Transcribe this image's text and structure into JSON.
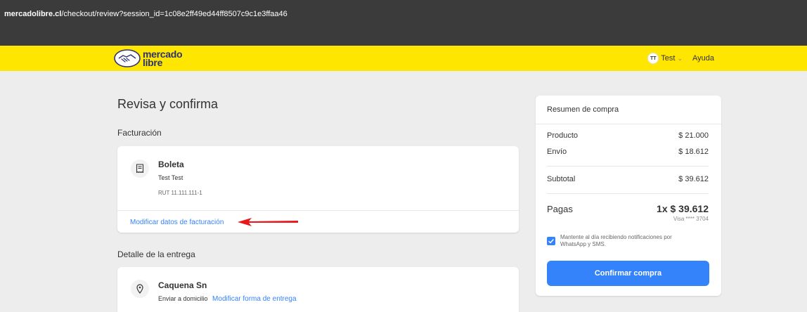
{
  "browser": {
    "url_host": "mercadolibre.cl",
    "url_path": "/checkout/review?session_id=1c08e2ff49ed44ff8507c9c1e3ffaa46"
  },
  "header": {
    "logo_line1": "mercado",
    "logo_line2": "libre",
    "user_initials": "TT",
    "user_name": "Test",
    "help_label": "Ayuda"
  },
  "main": {
    "title": "Revisa y confirma",
    "billing": {
      "section_title": "Facturación",
      "doc_type": "Boleta",
      "name": "Test Test",
      "rut": "RUT 11.111.111-1",
      "edit_link": "Modificar datos de facturación"
    },
    "delivery": {
      "section_title": "Detalle de la entrega",
      "address": "Caquena Sn",
      "method": "Enviar a domicilio",
      "edit_link": "Modificar forma de entrega"
    }
  },
  "summary": {
    "title": "Resumen de compra",
    "product_label": "Producto",
    "product_value": "$ 21.000",
    "shipping_label": "Envío",
    "shipping_value": "$ 18.612",
    "subtotal_label": "Subtotal",
    "subtotal_value": "$ 39.612",
    "pay_label": "Pagas",
    "pay_value": "1x $ 39.612",
    "card_info": "Visa **** 3704",
    "notify_text": "Mantente al día recibiendo notificaciones por WhatsApp y SMS.",
    "confirm_label": "Confirmar compra"
  },
  "colors": {
    "brand_yellow": "#ffe600",
    "accent_blue": "#3483fa",
    "annotation_red": "#e8181b"
  }
}
